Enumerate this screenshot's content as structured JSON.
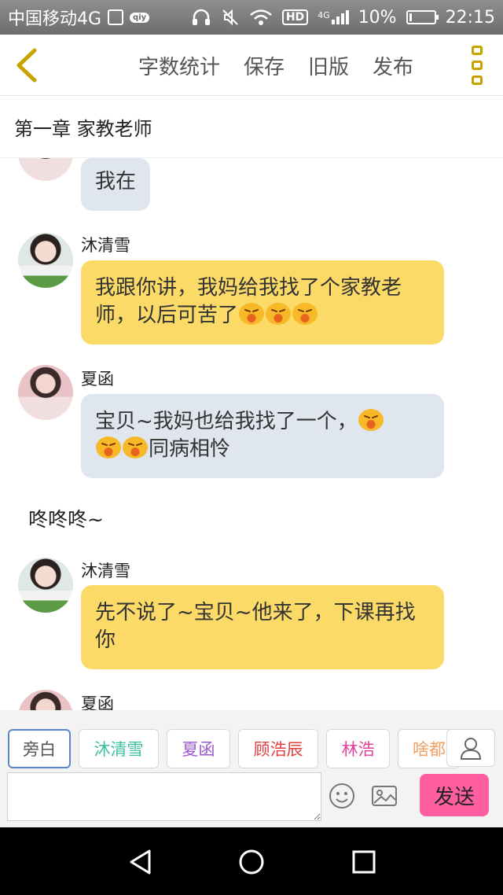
{
  "status_bar": {
    "carrier": "中国移动4G",
    "badge": "qiy",
    "hd": "HD",
    "network": "4G",
    "battery_percent": "10%",
    "battery_level": 0.1,
    "time": "22:15"
  },
  "toolbar": {
    "word_count": "字数统计",
    "save": "保存",
    "old_version": "旧版",
    "publish": "发布"
  },
  "chapter_title": "第一章 家教老师",
  "messages": [
    {
      "type": "bubble",
      "speaker": "",
      "text": "我在",
      "color": "gray"
    },
    {
      "type": "bubble",
      "speaker": "沐清雪",
      "text": "我跟你讲，我妈给我找了个家教老师，以后可苦了",
      "color": "yellow"
    },
    {
      "type": "bubble",
      "speaker": "夏函",
      "text_a": "宝贝~我妈也给我找了一个，",
      "text_b": "同病相怜",
      "color": "gray"
    },
    {
      "type": "narration",
      "text": "咚咚咚~"
    },
    {
      "type": "bubble",
      "speaker": "沐清雪",
      "text": "先不说了~宝贝~他来了，下课再找你",
      "color": "yellow"
    },
    {
      "type": "bubble",
      "speaker": "夏函",
      "text": "",
      "color": "gray"
    }
  ],
  "roles": [
    {
      "label": "旁白",
      "color": "#555555"
    },
    {
      "label": "沐清雪",
      "color": "#3bbf9f"
    },
    {
      "label": "夏函",
      "color": "#9b59d0"
    },
    {
      "label": "顾浩辰",
      "color": "#e04040"
    },
    {
      "label": "林浩",
      "color": "#e0409a"
    },
    {
      "label": "啥都",
      "color": "#f0a060"
    }
  ],
  "input": {
    "placeholder": ""
  },
  "send_label": "发送",
  "colors": {
    "bubble_yellow": "#fbda68",
    "bubble_gray": "#dfe6ee",
    "send_button": "#ff5fa0",
    "accent": "#c8a300"
  }
}
